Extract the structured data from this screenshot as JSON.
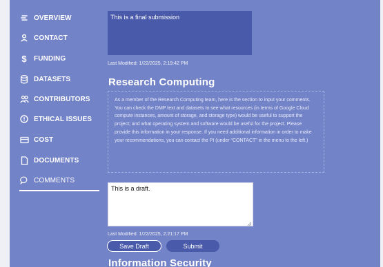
{
  "sidebar": {
    "items": [
      {
        "label": "OVERVIEW",
        "icon": "list-icon"
      },
      {
        "label": "CONTACT",
        "icon": "person-icon"
      },
      {
        "label": "FUNDING",
        "icon": "dollar-icon"
      },
      {
        "label": "DATASETS",
        "icon": "database-icon"
      },
      {
        "label": "CONTRIBUTORS",
        "icon": "people-icon"
      },
      {
        "label": "ETHICAL ISSUES",
        "icon": "alert-circle-icon"
      },
      {
        "label": "COST",
        "icon": "card-icon"
      },
      {
        "label": "DOCUMENTS",
        "icon": "document-icon"
      },
      {
        "label": "COMMENTS",
        "icon": "comment-icon"
      }
    ],
    "active": "COMMENTS"
  },
  "main": {
    "final_submission": {
      "value": "This is a final submission",
      "last_modified": "Last Modified: 1/22/2025, 2:19:42 PM"
    },
    "research_computing": {
      "title": "Research Computing",
      "notice": "As a member of the Research Computing team, here is the section to input your comments. You can check the DMP text and datasets to see what resources (in terms of Google Cloud compute instances, amount of storage, and storage type) would be useful to support the project; and what operating system and software would be useful for the project. Please provide this information in your response. If you need additional information in order to make your recommendations, you can contact the PI (under \"CONTACT\" in the menu to the left.)",
      "draft_value": "This is a draft.",
      "last_modified": "Last Modified: 1/22/2025, 2:21:17 PM",
      "save_label": "Save Draft",
      "submit_label": "Submit"
    },
    "next_section_title": "Information Security"
  },
  "colors": {
    "background": "#7383c7",
    "accent": "#4a5aaa",
    "text": "#ffffff"
  }
}
